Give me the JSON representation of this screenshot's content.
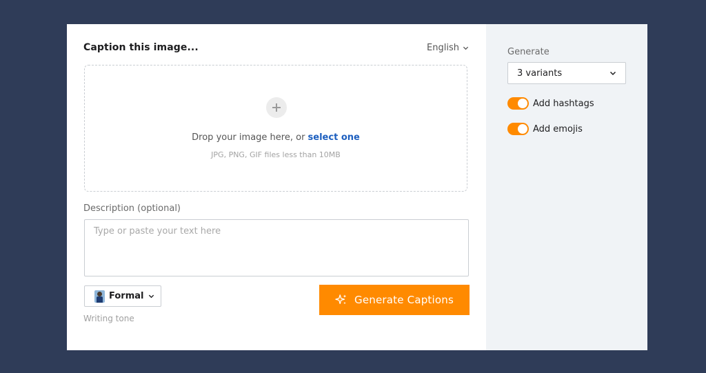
{
  "header": {
    "title": "Caption this image...",
    "language": "English"
  },
  "dropzone": {
    "text_prefix": "Drop your image here, or ",
    "link": "select one",
    "hint": "JPG, PNG, GIF files less than 10MB"
  },
  "description": {
    "label": "Description (optional)",
    "placeholder": "Type or paste your text here",
    "value": ""
  },
  "tone": {
    "value": "Formal",
    "caption": "Writing tone"
  },
  "generate_button": {
    "label": "Generate Captions"
  },
  "sidebar": {
    "generate_label": "Generate",
    "variants_value": "3 variants",
    "hashtags_label": "Add hashtags",
    "hashtags_on": true,
    "emojis_label": "Add emojis",
    "emojis_on": true
  },
  "colors": {
    "background": "#2f3c58",
    "accent": "#ff8a00",
    "link": "#1d5fbf",
    "sidebar": "#f0f3f6"
  }
}
